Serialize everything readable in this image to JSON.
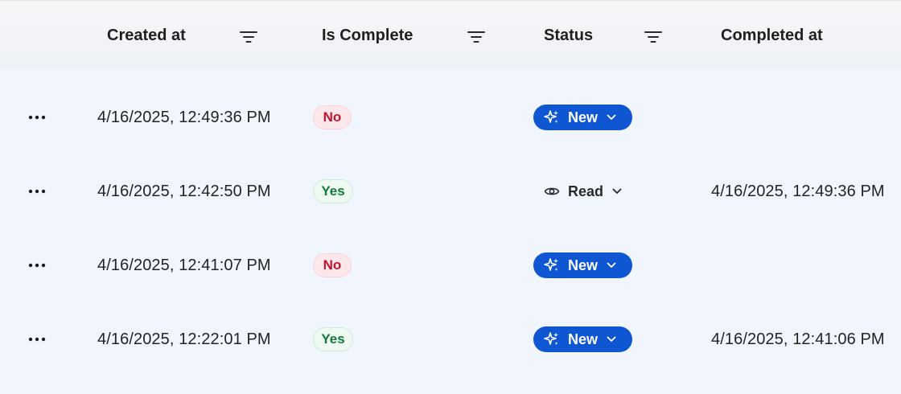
{
  "columns": {
    "created_at": "Created at",
    "is_complete": "Is Complete",
    "status": "Status",
    "completed_at": "Completed at"
  },
  "rows": [
    {
      "created_at": "4/16/2025, 12:49:36 PM",
      "is_complete": "No",
      "status": "New",
      "completed_at": ""
    },
    {
      "created_at": "4/16/2025, 12:42:50 PM",
      "is_complete": "Yes",
      "status": "Read",
      "completed_at": "4/16/2025, 12:49:36 PM"
    },
    {
      "created_at": "4/16/2025, 12:41:07 PM",
      "is_complete": "No",
      "status": "New",
      "completed_at": ""
    },
    {
      "created_at": "4/16/2025, 12:22:01 PM",
      "is_complete": "Yes",
      "status": "New",
      "completed_at": "4/16/2025, 12:41:06 PM"
    }
  ],
  "icons": {
    "filter": "filter-icon",
    "more": "more-options-icon",
    "new_status": "sparkle-icon",
    "read_status": "eye-icon",
    "dropdown": "chevron-down-icon"
  },
  "colors": {
    "status_new_bg": "#0f56d3",
    "no_text": "#c4132e",
    "no_bg": "#fde7ea",
    "yes_text": "#137a3c",
    "yes_bg": "#edf9f1"
  }
}
